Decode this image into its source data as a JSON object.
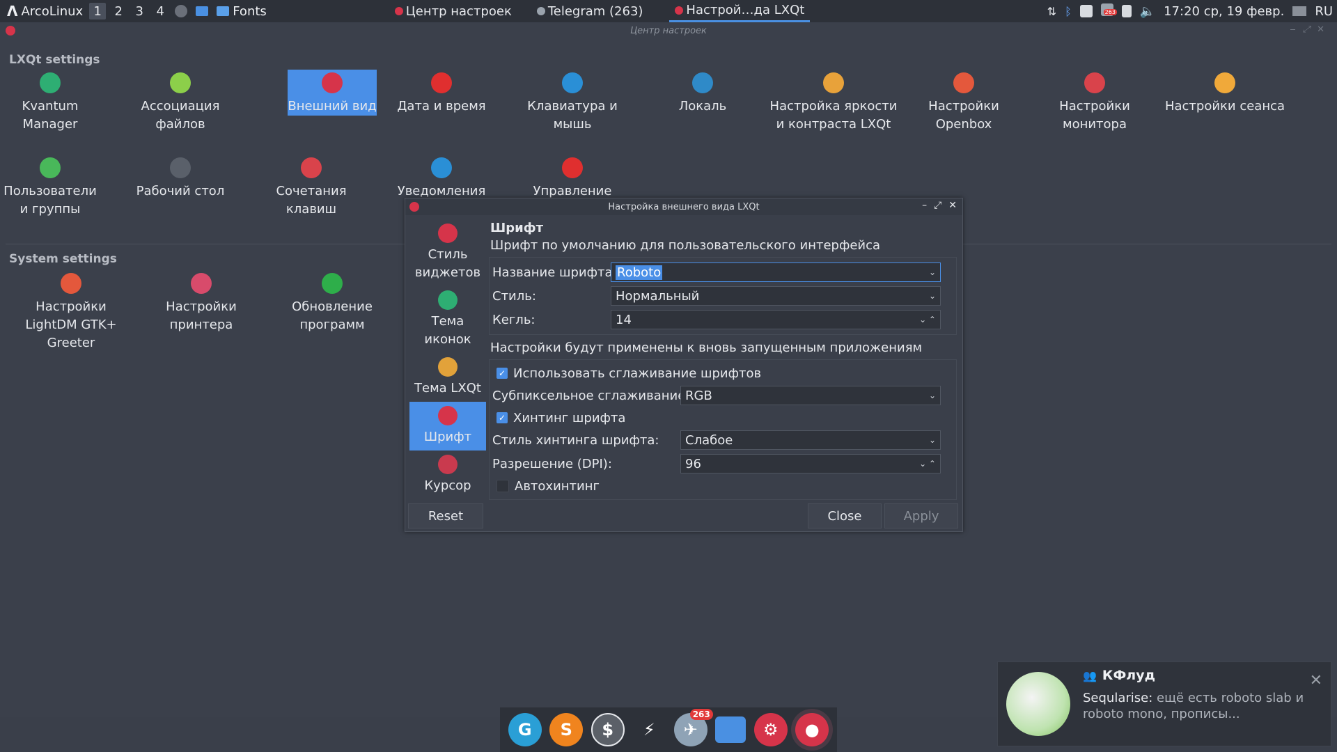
{
  "panel": {
    "brand": "ArcoLinux",
    "workspaces": [
      "1",
      "2",
      "3",
      "4"
    ],
    "folder_label": "Fonts",
    "tasks": [
      {
        "label": "Центр настроек"
      },
      {
        "label": "Telegram (263)"
      },
      {
        "label": "Настрой…да LXQt"
      }
    ],
    "clock": "17:20 ср, 19 февр.",
    "lang": "RU",
    "tray_badge": "263"
  },
  "main": {
    "title": "Центр настроек",
    "lxqt_section": "LXQt settings",
    "system_section": "System settings",
    "lxqt_items": [
      {
        "label": "Kvantum Manager",
        "color": "#2eae73"
      },
      {
        "label": "Ассоциация файлов",
        "color": "#8ccf4a"
      },
      {
        "label": "Внешний вид",
        "color": "#d6344a"
      },
      {
        "label": "Дата и время",
        "color": "#e02f2f"
      },
      {
        "label": "Клавиатура и мышь",
        "color": "#2a8fd6"
      },
      {
        "label": "Локаль",
        "color": "#2f8ac8"
      },
      {
        "label": "Настройка яркости и контраста LXQt",
        "color": "#e8a23a"
      },
      {
        "label": "Настройки Openbox",
        "color": "#e4583c"
      },
      {
        "label": "Настройки монитора",
        "color": "#d9434b"
      },
      {
        "label": "Настройки сеанса",
        "color": "#f0a93a"
      },
      {
        "label": "Пользователи и группы",
        "color": "#49b85a"
      },
      {
        "label": "Рабочий стол",
        "color": "#5a606a"
      },
      {
        "label": "Сочетания клавиш",
        "color": "#d9434b"
      },
      {
        "label": "Уведомления",
        "color": "#2a8fd6"
      },
      {
        "label": "Управление",
        "color": "#e02f2f"
      }
    ],
    "system_items": [
      {
        "label": "Настройки LightDM GTK+ Greeter",
        "color": "#e4583c"
      },
      {
        "label": "Настройки принтера",
        "color": "#d84b6b"
      },
      {
        "label": "Обновление программ",
        "color": "#2eae4a"
      }
    ]
  },
  "dialog": {
    "title": "Настройка внешнего вида LXQt",
    "side_items": [
      {
        "label": "Стиль виджетов",
        "color": "#d6344a"
      },
      {
        "label": "Тема иконок",
        "color": "#2eae73"
      },
      {
        "label": "Тема LXQt",
        "color": "#e2a23a"
      },
      {
        "label": "Шрифт",
        "color": "#d6344a"
      },
      {
        "label": "Курсор",
        "color": "#c93a4e"
      }
    ],
    "heading": "Шрифт",
    "subheading": "Шрифт по умолчанию для пользовательского интерфейса",
    "font_name_label": "Название шрифта:",
    "font_name_value": "Roboto",
    "style_label": "Стиль:",
    "style_value": "Нормальный",
    "size_label": "Кегль:",
    "size_value": "14",
    "note": "Настройки будут применены к вновь запущенным приложениям",
    "antialias_label": "Использовать сглаживание шрифтов",
    "antialias_checked": true,
    "subpixel_label": "Субпиксельное сглаживание:",
    "subpixel_value": "RGB",
    "hinting_label": "Хинтинг шрифта",
    "hinting_checked": true,
    "hint_style_label": "Стиль хинтинга шрифта:",
    "hint_style_value": "Слабое",
    "dpi_label": "Разрешение (DPI):",
    "dpi_value": "96",
    "autohint_label": "Автохинтинг",
    "autohint_checked": false,
    "reset_label": "Reset",
    "close_label": "Close",
    "apply_label": "Apply"
  },
  "dock": {
    "telegram_badge": "263"
  },
  "notification": {
    "title": "КФлуд",
    "sender": "Seqularise:",
    "message": "ещё есть roboto slab и roboto mono, прописы..."
  }
}
